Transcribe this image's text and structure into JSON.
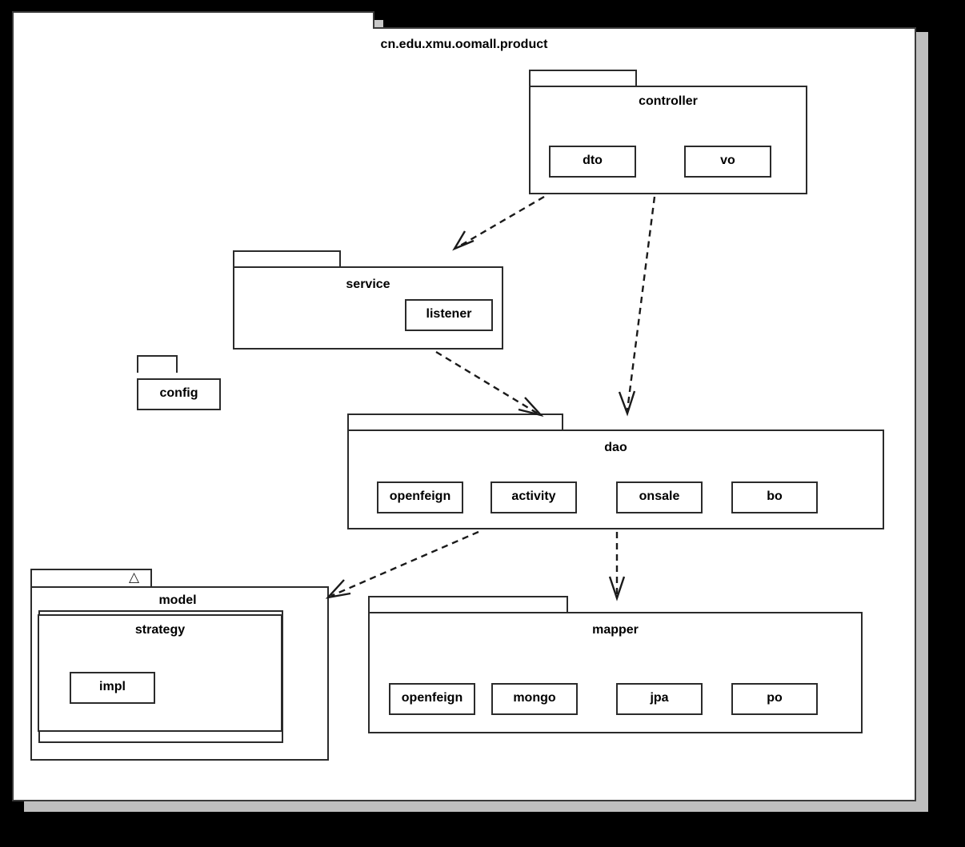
{
  "diagram": {
    "title": "cn.edu.xmu.oomall.product",
    "type": "uml-package-diagram",
    "outer_tab_label": "",
    "background_color": "#000000",
    "surface_color": "#ffffff",
    "line_color": "#2b2b2b",
    "shadow_color": "#f0f0f0"
  },
  "packages": {
    "controller": {
      "label": "controller",
      "children": [
        {
          "label": "dto"
        },
        {
          "label": "vo"
        }
      ]
    },
    "service": {
      "label": "service",
      "children": [
        {
          "label": "listener"
        }
      ]
    },
    "config": {
      "label": "config",
      "children": []
    },
    "dao": {
      "label": "dao",
      "children": [
        {
          "label": "openfeign"
        },
        {
          "label": "activity"
        },
        {
          "label": "onsale"
        },
        {
          "label": "bo"
        }
      ]
    },
    "model": {
      "label": "model",
      "tab_glyph": "triangle-up-icon",
      "tab_glyph_char": "△",
      "children": [
        {
          "label": "strategy",
          "children": [
            {
              "label": "impl"
            }
          ]
        }
      ]
    },
    "mapper": {
      "label": "mapper",
      "children": [
        {
          "label": "openfeign"
        },
        {
          "label": "mongo"
        },
        {
          "label": "jpa"
        },
        {
          "label": "po"
        }
      ]
    }
  },
  "dependencies": [
    {
      "from": "controller",
      "to": "service",
      "style": "dashed",
      "arrow": "open"
    },
    {
      "from": "controller",
      "to": "dao",
      "style": "dashed",
      "arrow": "open"
    },
    {
      "from": "service",
      "to": "dao",
      "style": "dashed",
      "arrow": "open"
    },
    {
      "from": "dao",
      "to": "model",
      "style": "dashed",
      "arrow": "open"
    },
    {
      "from": "dao",
      "to": "mapper",
      "style": "dashed",
      "arrow": "open"
    }
  ]
}
